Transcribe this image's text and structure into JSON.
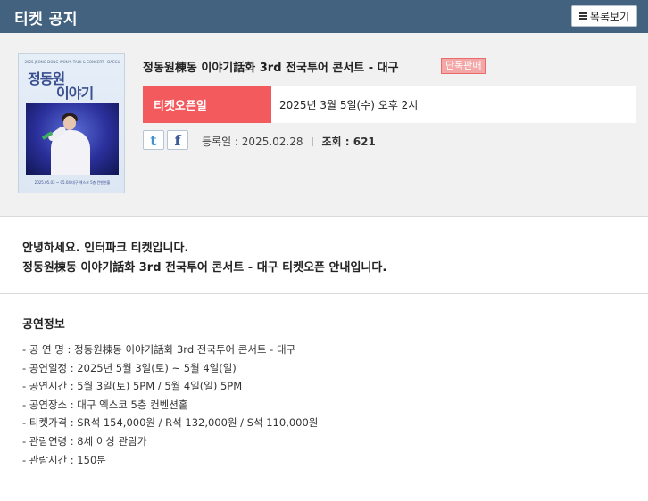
{
  "header": {
    "title": "티켓 공지",
    "list_button_label": "목록보기"
  },
  "poster": {
    "top_caption": "2025 JEONG DONG WON'S TALK & CONCERT - DAEGU",
    "title_line1": "정동원",
    "title_line2": "이야기",
    "bottom_caption": "2025.05.03 ~ 05.04 대구 엑스코 5층 컨벤션홀"
  },
  "concert": {
    "title": "정동원棟동 이야기話화 3rd 전국투어 콘서트 - 대구",
    "badge": "단독판매",
    "open_label": "티켓오픈일",
    "open_date": "2025년 3월 5일(수) 오후 2시"
  },
  "meta": {
    "registered": "등록일 : 2025.02.28",
    "views": "조회 : 621"
  },
  "share": {
    "twitter": "t",
    "facebook": "f"
  },
  "greeting": {
    "line1": "안녕하세요. 인터파크 티켓입니다.",
    "line2": "정동원棟동 이야기話화 3rd 전국투어 콘서트 - 대구 티켓오픈 안내입니다."
  },
  "info": {
    "section_title": "공연정보",
    "items": [
      "- 공 연 명 : 정동원棟동 이야기話화 3rd 전국투어 콘서트 - 대구",
      "- 공연일정 : 2025년 5월 3일(토) ~ 5월 4일(일)",
      "- 공연시간 : 5월 3일(토) 5PM / 5월 4일(일) 5PM",
      "- 공연장소 : 대구 엑스코 5층 컨벤션홀",
      "- 티켓가격 : SR석 154,000원 / R석 132,000원 / S석 110,000원",
      "- 관람연령 : 8세 이상 관람가",
      "- 관람시간 : 150분"
    ]
  },
  "colors": {
    "header_bg": "#43627f",
    "open_label_bg": "#f35a5e",
    "badge_bg": "#f4a7a7"
  }
}
